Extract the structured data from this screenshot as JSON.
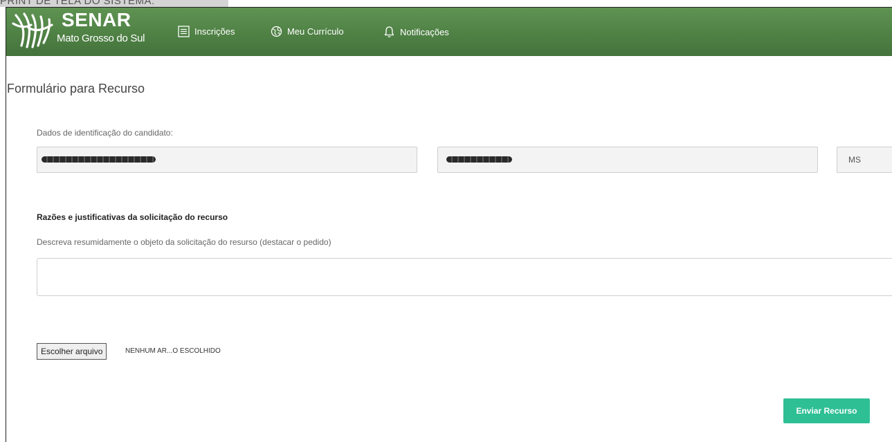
{
  "caption": "PRINT DE TELA DO SISTEMA:",
  "header": {
    "logo_title": "SENAR",
    "logo_subtitle": "Mato Grosso do Sul",
    "nav": [
      {
        "label": "Inscrições",
        "icon": "list-icon"
      },
      {
        "label": "Meu Currículo",
        "icon": "globe-icon"
      },
      {
        "label": "Notificações",
        "icon": "bell-icon"
      }
    ],
    "bg_color": "#4f8145"
  },
  "form": {
    "title": "Formulário para Recurso",
    "identification_label": "Dados de identificação do candidato:",
    "fields": [
      {
        "value": "",
        "redacted": true
      },
      {
        "value": "",
        "redacted": true
      },
      {
        "value": "MS",
        "redacted": false
      }
    ],
    "reasons_heading": "Razões e justificativas da solicitação do recurso",
    "reasons_help": "Descreva resumidamente o objeto da solicitação do resurso (destacar o pedido)",
    "reasons_value": "",
    "file_button_label": "Escolher arquivo",
    "file_status": "NENHUM AR...O ESCOLHIDO",
    "submit_label": "Enviar Recurso",
    "submit_color": "#2fbf95"
  }
}
